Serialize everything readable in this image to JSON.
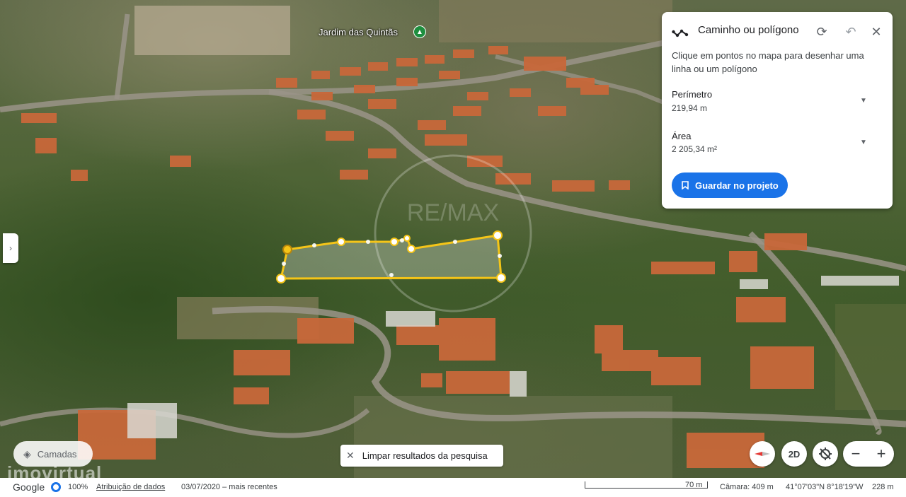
{
  "map": {
    "place_label": "Jardim das Quintãs",
    "watermark": "imovirtual",
    "polygon_note": "area outline"
  },
  "measure_panel": {
    "title": "Caminho ou polígono",
    "description": "Clique em pontos no mapa para desenhar uma linha ou um polígono",
    "perimeter_label": "Perímetro",
    "perimeter_value": "219,94 m",
    "area_label": "Área",
    "area_value": "2 205,34 m²",
    "save_label": "Guardar no projeto",
    "accent_color": "#1a73e8"
  },
  "controls": {
    "layers_label": "Camadas",
    "clear_label": "Limpar resultados da pesquisa",
    "view_2d_label": "2D",
    "zoom_out_label": "−",
    "zoom_in_label": "+"
  },
  "status_bar": {
    "logo": "Google",
    "zoom_percent": "100%",
    "attribution": "Atribuição de dados",
    "imagery_date": "03/07/2020 – mais recentes",
    "scale_label": "70 m",
    "camera": "Câmara: 409 m",
    "coordinates": "41°07'03\"N 8°18'19\"W",
    "altitude": "228 m"
  }
}
